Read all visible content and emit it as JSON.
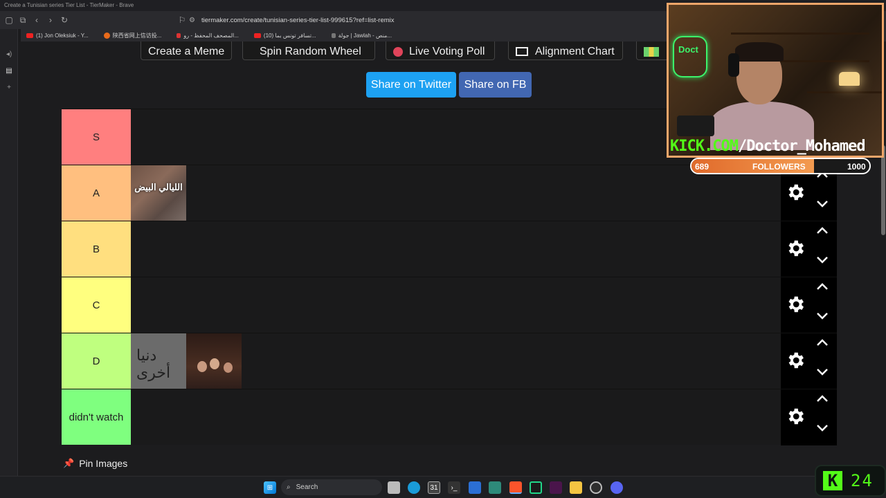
{
  "browser": {
    "window_title": "Create a Tunisian series Tier List - TierMaker - Brave",
    "url": "tiermaker.com/create/tunisian-series-tier-list-999615?ref=list-remix",
    "bookmarks": [
      {
        "label": "(1) Jon Oleksiuk - Y...",
        "color": "#e22"
      },
      {
        "label": "陕西省网上信访投...",
        "color": "#e86a1a"
      },
      {
        "label": "المصحف المحفظ - رو...",
        "color": "#d33"
      },
      {
        "label": "(10) تسافر تونس بما...",
        "color": "#e22"
      },
      {
        "label": "جولة | Jawlah - منص...",
        "color": "#888"
      }
    ]
  },
  "toolbar": {
    "buttons": [
      "Create a Meme",
      "Spin Random Wheel",
      "Live Voting Poll",
      "Alignment Chart"
    ],
    "share_twitter": "Share on Twitter",
    "share_fb": "Share on FB"
  },
  "tiers": [
    {
      "label": "S",
      "color": "#ff7f7f",
      "items": []
    },
    {
      "label": "A",
      "color": "#ffbf7f",
      "items": [
        {
          "title": "الليالي البيض"
        }
      ]
    },
    {
      "label": "B",
      "color": "#ffdf7f",
      "items": []
    },
    {
      "label": "C",
      "color": "#ffff7f",
      "items": []
    },
    {
      "label": "D",
      "color": "#bfff7f",
      "items": [
        {
          "title": "دنيا أخرى"
        },
        {
          "title": ""
        }
      ]
    },
    {
      "label": "didn't watch",
      "color": "#7fff7f",
      "items": []
    }
  ],
  "pin_images_label": "Pin Images",
  "stream_overlay": {
    "kick_handle_prefix": "KICK.COM",
    "kick_handle_suffix": "/Doctor_Mohamed",
    "neon_sign": "Doct",
    "followers_current": "689",
    "followers_label": "FOLLOWERS",
    "followers_goal": "1000",
    "followers_progress": 0.689,
    "viewer_count": "24",
    "kick_logo": "K"
  },
  "taskbar": {
    "search_placeholder": "Search"
  }
}
